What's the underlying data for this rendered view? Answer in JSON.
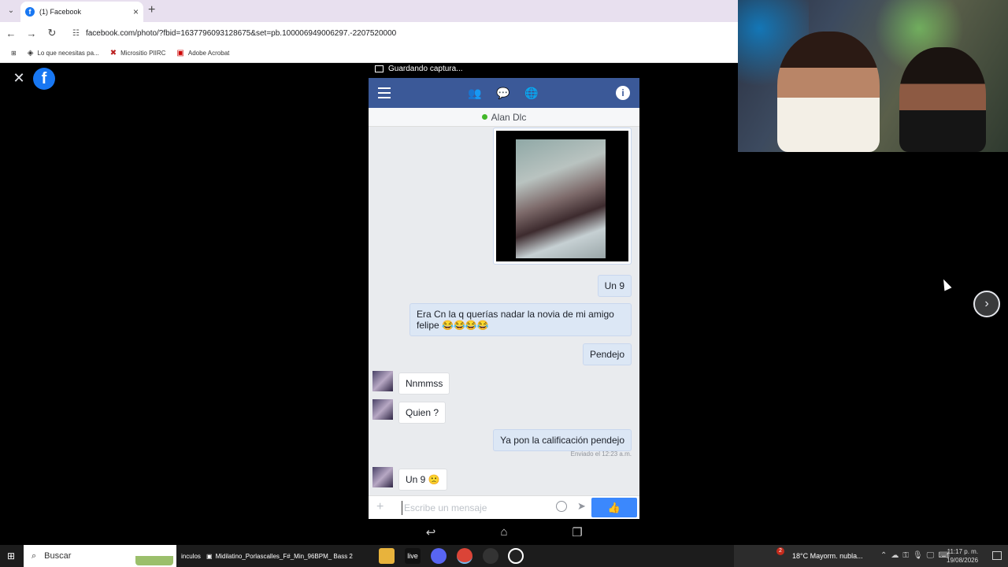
{
  "browser": {
    "tab_title": "(1) Facebook",
    "url": "facebook.com/photo/?fbid=1637796093128675&set=pb.100006949006297.-2207520000",
    "bookmarks": [
      {
        "label": "Lo que necesitas pa...",
        "icon": "diamond-icon"
      },
      {
        "label": "Micrositio PIIRC",
        "icon": "microsite-icon"
      },
      {
        "label": "Adobe Acrobat",
        "icon": "acrobat-icon"
      }
    ]
  },
  "viewer": {
    "fb_logo": "f",
    "saving_text": "Guardando captura...",
    "next_glyph": "›",
    "close_glyph": "✕"
  },
  "chat": {
    "contact_name": "Alan Dlc",
    "messages": [
      {
        "dir": "out",
        "text": "Un 9"
      },
      {
        "dir": "out",
        "text": "Era Cn la q querías nadar la novia de mi amigo felipe 😂😂😂😂"
      },
      {
        "dir": "out",
        "text": "Pendejo"
      },
      {
        "dir": "in",
        "text": "Nnmmss"
      },
      {
        "dir": "in",
        "text": "Quien ?"
      },
      {
        "dir": "out",
        "text": "Ya pon la calificación pendejo"
      },
      {
        "dir": "in",
        "text": "Un 9 🙁"
      }
    ],
    "sent_note": "Enviado el 12:23 a.m.",
    "composer_placeholder": "Escribe un mensaje",
    "colors": {
      "header": "#3b5998",
      "like_button": "#3b88fd"
    }
  },
  "taskbar": {
    "search_label": "Buscar",
    "partial_label": "inculos",
    "task_title": "Midilatino_Porlascalles_F#_Min_96BPM_ Bass 2",
    "live_label": "live",
    "weather": "18°C  Mayorm. nubla...",
    "weather_badge": "2",
    "time": "11:17 p. m.",
    "date": "19/08/2026"
  }
}
